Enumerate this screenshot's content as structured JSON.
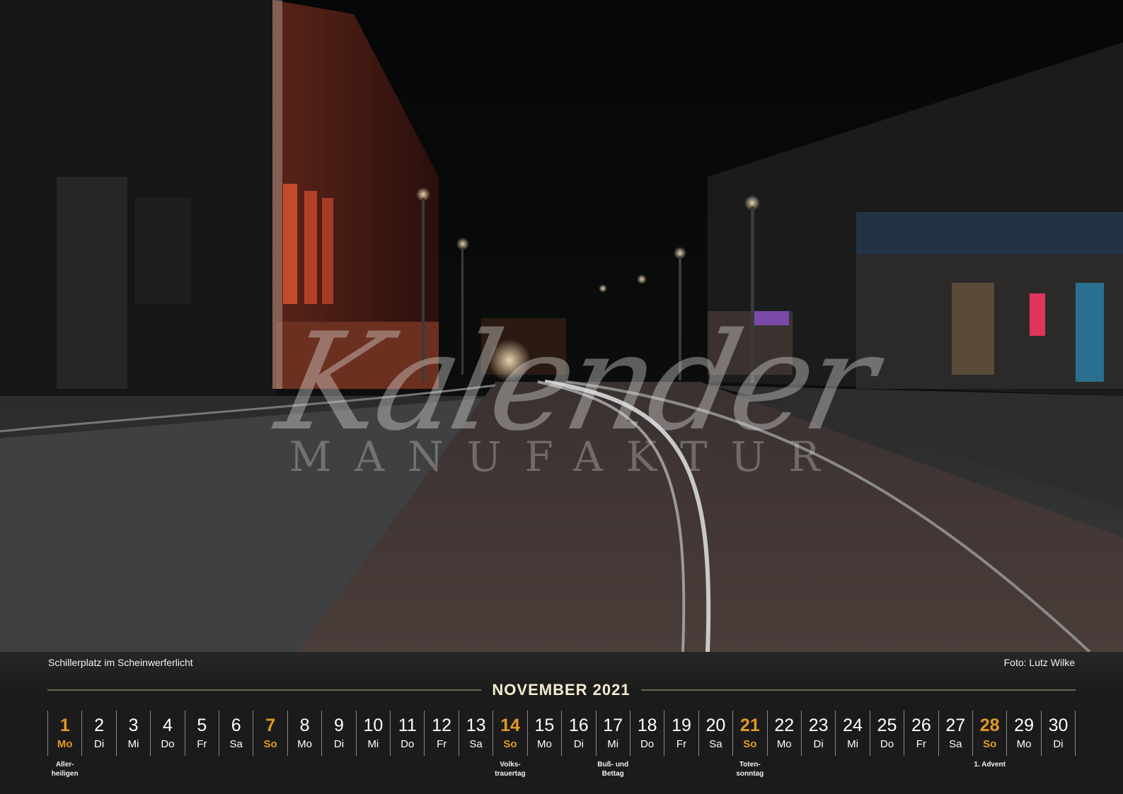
{
  "photo": {
    "caption": "Schillerplatz im Scheinwerferlicht",
    "credit": "Foto: Lutz Wilke",
    "watermark_script": "Kalender",
    "watermark_brand": "MANUFAKTUR"
  },
  "calendar": {
    "month_title": "NOVEMBER 2021",
    "highlight_color": "#e39a22",
    "days": [
      {
        "num": "1",
        "dow": "Mo",
        "hl": true,
        "note": "Aller-\nheiligen"
      },
      {
        "num": "2",
        "dow": "Di",
        "hl": false,
        "note": ""
      },
      {
        "num": "3",
        "dow": "Mi",
        "hl": false,
        "note": ""
      },
      {
        "num": "4",
        "dow": "Do",
        "hl": false,
        "note": ""
      },
      {
        "num": "5",
        "dow": "Fr",
        "hl": false,
        "note": ""
      },
      {
        "num": "6",
        "dow": "Sa",
        "hl": false,
        "note": ""
      },
      {
        "num": "7",
        "dow": "So",
        "hl": true,
        "note": ""
      },
      {
        "num": "8",
        "dow": "Mo",
        "hl": false,
        "note": ""
      },
      {
        "num": "9",
        "dow": "Di",
        "hl": false,
        "note": ""
      },
      {
        "num": "10",
        "dow": "Mi",
        "hl": false,
        "note": ""
      },
      {
        "num": "11",
        "dow": "Do",
        "hl": false,
        "note": ""
      },
      {
        "num": "12",
        "dow": "Fr",
        "hl": false,
        "note": ""
      },
      {
        "num": "13",
        "dow": "Sa",
        "hl": false,
        "note": ""
      },
      {
        "num": "14",
        "dow": "So",
        "hl": true,
        "note": "Volks-\ntrauertag"
      },
      {
        "num": "15",
        "dow": "Mo",
        "hl": false,
        "note": ""
      },
      {
        "num": "16",
        "dow": "Di",
        "hl": false,
        "note": ""
      },
      {
        "num": "17",
        "dow": "Mi",
        "hl": false,
        "note": "Buß- und\nBettag"
      },
      {
        "num": "18",
        "dow": "Do",
        "hl": false,
        "note": ""
      },
      {
        "num": "19",
        "dow": "Fr",
        "hl": false,
        "note": ""
      },
      {
        "num": "20",
        "dow": "Sa",
        "hl": false,
        "note": ""
      },
      {
        "num": "21",
        "dow": "So",
        "hl": true,
        "note": "Toten-\nsonntag"
      },
      {
        "num": "22",
        "dow": "Mo",
        "hl": false,
        "note": ""
      },
      {
        "num": "23",
        "dow": "Di",
        "hl": false,
        "note": ""
      },
      {
        "num": "24",
        "dow": "Mi",
        "hl": false,
        "note": ""
      },
      {
        "num": "25",
        "dow": "Do",
        "hl": false,
        "note": ""
      },
      {
        "num": "26",
        "dow": "Fr",
        "hl": false,
        "note": ""
      },
      {
        "num": "27",
        "dow": "Sa",
        "hl": false,
        "note": ""
      },
      {
        "num": "28",
        "dow": "So",
        "hl": true,
        "note": "1. Advent"
      },
      {
        "num": "29",
        "dow": "Mo",
        "hl": false,
        "note": ""
      },
      {
        "num": "30",
        "dow": "Di",
        "hl": false,
        "note": ""
      }
    ]
  }
}
